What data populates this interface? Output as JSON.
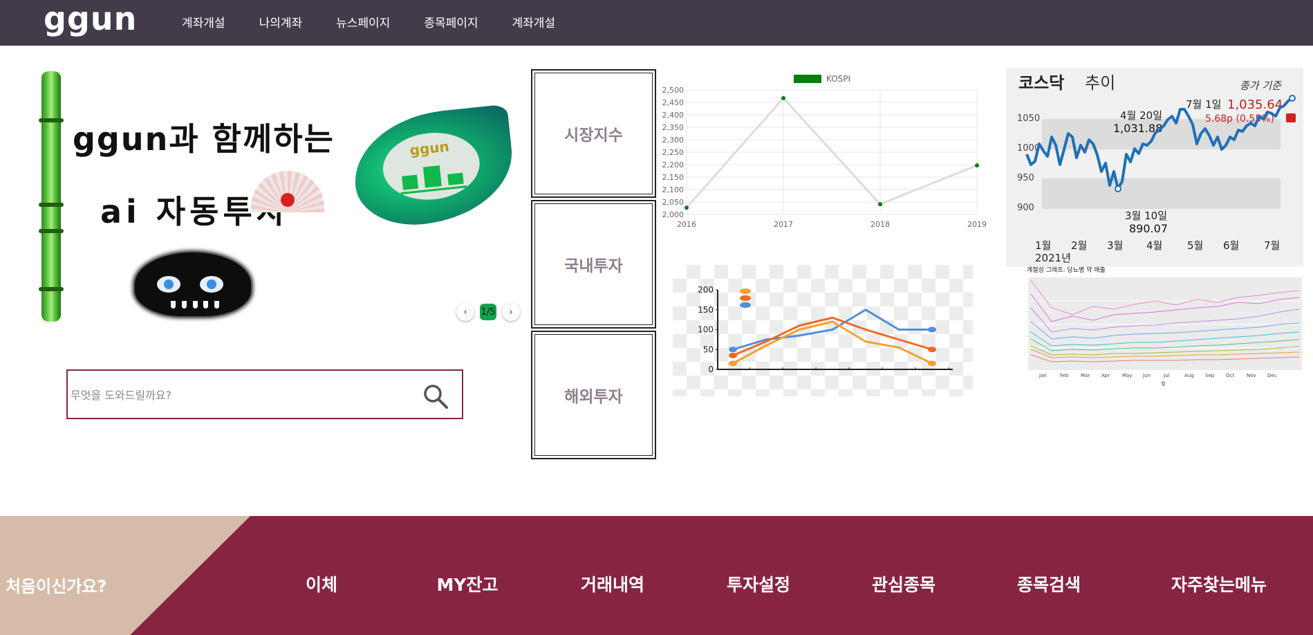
{
  "header": {
    "logo": "ggun",
    "nav": [
      "계좌개설",
      "나의계좌",
      "뉴스페이지",
      "종목페이지",
      "계좌개설"
    ]
  },
  "banner": {
    "line1": "ggun과 함께하는",
    "line2": "ai 자동투자",
    "badge_text": "ggun",
    "pager": {
      "indicator": "1/5",
      "prev": "‹",
      "next": "›"
    }
  },
  "search": {
    "placeholder": "무엇을 도와드릴까요?"
  },
  "categories": [
    "시장지수",
    "국내투자",
    "해외투자"
  ],
  "chart_data": [
    {
      "type": "line",
      "legend": [
        "KOSPI"
      ],
      "x": [
        "2016",
        "2017",
        "2018",
        "2019"
      ],
      "series": [
        {
          "name": "KOSPI",
          "values": [
            2027,
            2467,
            2041,
            2197
          ]
        }
      ],
      "ylim": [
        2000,
        2500
      ],
      "yticks": [
        "2,500",
        "2,450",
        "2,400",
        "2,350",
        "2,300",
        "2,250",
        "2,200",
        "2,150",
        "2,100",
        "2,050",
        "2,000"
      ],
      "legend_position": "top",
      "grid": true,
      "colors": {
        "legend": "#0a7d0a",
        "line": "#dddddd",
        "points": "#0a7d0a"
      }
    },
    {
      "type": "line",
      "yticks": [
        "200",
        "150",
        "100",
        "50",
        "0"
      ],
      "ylim": [
        0,
        200
      ],
      "series": [
        {
          "values": [
            50,
            75,
            85,
            100,
            150,
            100,
            100
          ],
          "color": "#4f8fdc"
        },
        {
          "values": [
            35,
            70,
            110,
            130,
            100,
            75,
            50
          ],
          "color": "#ef6a22"
        },
        {
          "values": [
            15,
            60,
            100,
            120,
            70,
            55,
            15
          ],
          "color": "#f2a134"
        }
      ],
      "grid": false,
      "legend_position": "top-left"
    }
  ],
  "kosdaq": {
    "title_bold": "코스닥",
    "title_rest": "추이",
    "basis": "종가 기준",
    "latest_date": "7월 1일",
    "latest_value": "1,035.64",
    "change": "5.68p (0.55%)",
    "high_label": "4월 20일",
    "high_value": "1,031.88",
    "low_label": "3월 10일",
    "low_value": "890.07",
    "yticks": [
      "1050",
      "1000",
      "950",
      "900"
    ],
    "xticks": [
      "1월",
      "2월",
      "3월",
      "4월",
      "5월",
      "6월",
      "7월"
    ],
    "year": "2021년",
    "colors": {
      "line": "#1f6fb6",
      "accent": "#d22222"
    }
  },
  "heatmap": {
    "title": "계절성 그래프: 당뇨병 약 매출",
    "xticks": [
      "Jan",
      "Feb",
      "Mar",
      "Apr",
      "May",
      "Jun",
      "Jul",
      "Aug",
      "Sep",
      "Oct",
      "Nov",
      "Dec"
    ],
    "xlabel": "월"
  },
  "footer": {
    "first_time": "처음이신가요?",
    "menu": [
      "이체",
      "MY잔고",
      "거래내역",
      "투자설정",
      "관심종목",
      "종목검색",
      "자주찾는메뉴"
    ],
    "colors": {
      "band": "#862442",
      "triangle": "#d7bba9"
    }
  }
}
